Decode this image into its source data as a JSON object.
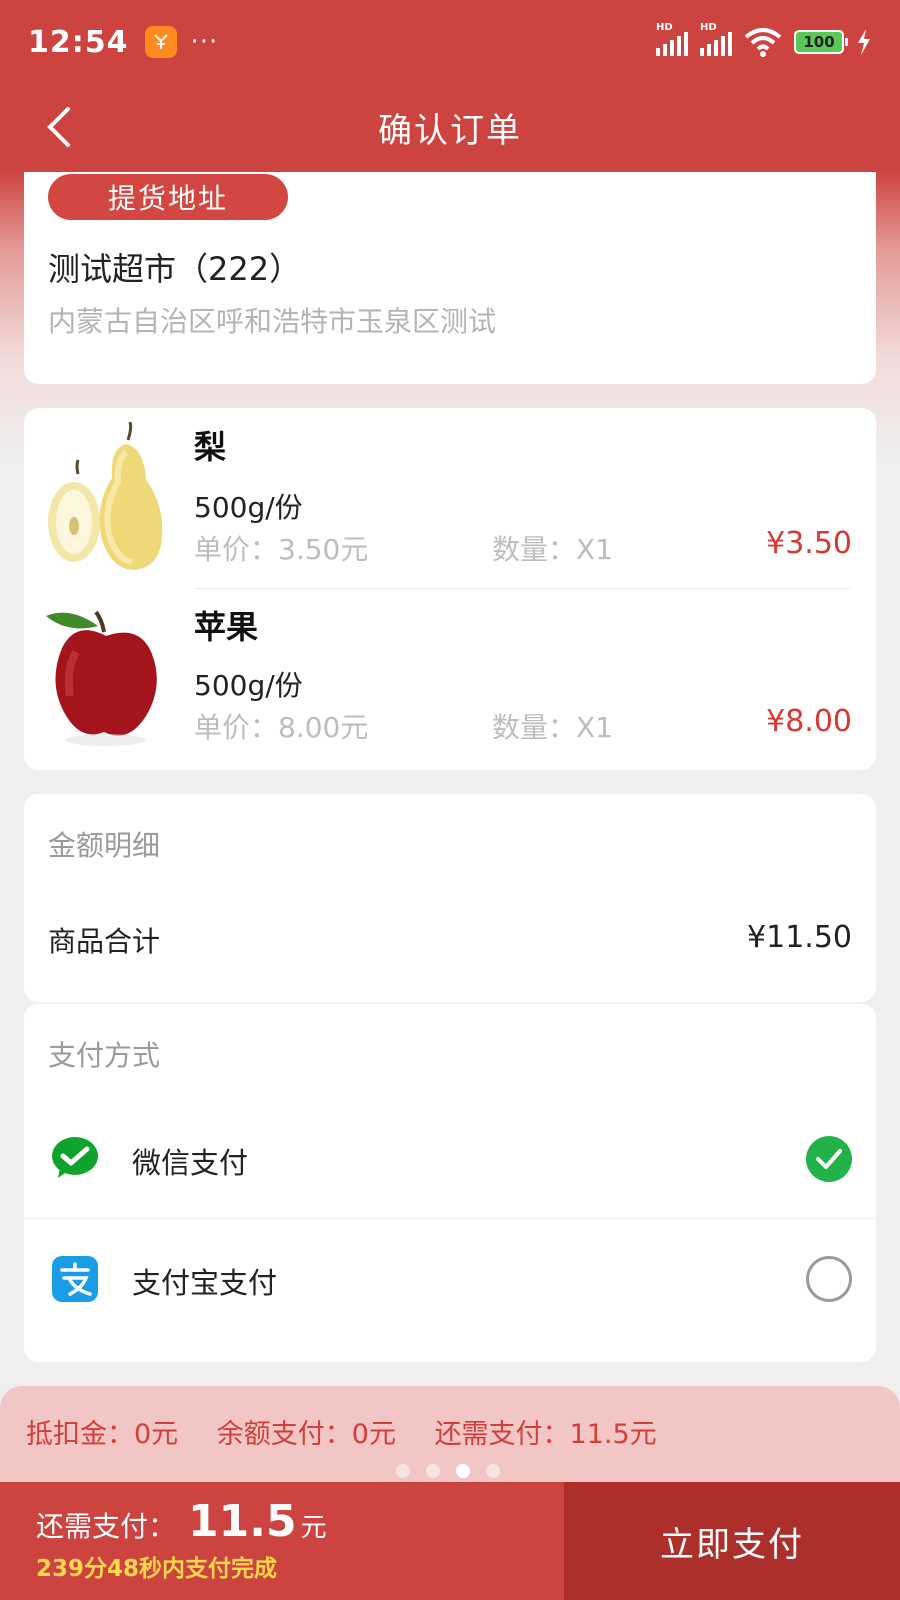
{
  "status_bar": {
    "time": "12:54",
    "more": "···",
    "hd1": "HD",
    "hd2": "HD",
    "battery": "100"
  },
  "nav": {
    "title": "确认订单"
  },
  "pickup": {
    "tag": "提货地址",
    "store": "测试超市（222）",
    "address": "内蒙古自治区呼和浩特市玉泉区测试"
  },
  "products": [
    {
      "name": "梨",
      "spec": "500g/份",
      "unit_price": "单价：3.50元",
      "quantity": "数量：X1",
      "price": "¥3.50",
      "image": "pear"
    },
    {
      "name": "苹果",
      "spec": "500g/份",
      "unit_price": "单价：8.00元",
      "quantity": "数量：X1",
      "price": "¥8.00",
      "image": "apple"
    }
  ],
  "amount": {
    "title": "金额明细",
    "subtotal_label": "商品合计",
    "subtotal_value": "¥11.50"
  },
  "payment": {
    "title": "支付方式",
    "options": [
      {
        "label": "微信支付",
        "icon": "wechat-icon",
        "selected": true
      },
      {
        "label": "支付宝支付",
        "icon": "alipay-icon",
        "selected": false
      }
    ]
  },
  "summary": {
    "deduction": "抵扣金：0元",
    "balance": "余额支付：0元",
    "remaining": "还需支付：11.5元",
    "page_dots_active": 3,
    "page_dots_total": 4
  },
  "bottom": {
    "need_label": "还需支付：",
    "need_amount": "11.5",
    "need_unit": "元",
    "countdown": "239分48秒内支付完成",
    "pay_button": "立即支付"
  },
  "colors": {
    "brand_red": "#cc4340",
    "price_red": "#d33a36",
    "pay_button": "#ad2f2c",
    "countdown_yellow": "#ffd84d",
    "wechat_green": "#23b24a",
    "alipay_blue": "#1a9ce6"
  }
}
